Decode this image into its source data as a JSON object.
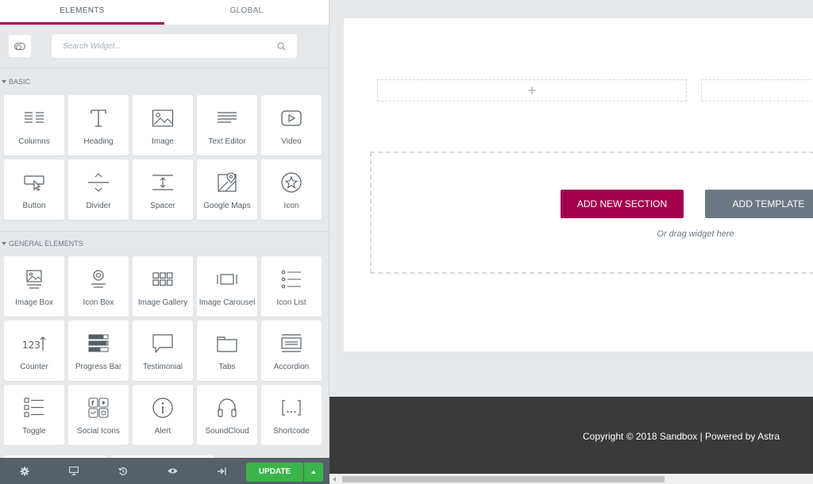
{
  "panel": {
    "tabs": [
      {
        "label": "ELEMENTS",
        "active": true
      },
      {
        "label": "GLOBAL",
        "active": false
      }
    ],
    "search": {
      "placeholder": "Search Widget..."
    },
    "categories": [
      {
        "title": "BASIC",
        "widgets": [
          {
            "label": "Columns",
            "icon": "columns-icon"
          },
          {
            "label": "Heading",
            "icon": "heading-icon"
          },
          {
            "label": "Image",
            "icon": "image-icon"
          },
          {
            "label": "Text Editor",
            "icon": "text-editor-icon"
          },
          {
            "label": "Video",
            "icon": "video-icon"
          },
          {
            "label": "Button",
            "icon": "button-icon"
          },
          {
            "label": "Divider",
            "icon": "divider-icon"
          },
          {
            "label": "Spacer",
            "icon": "spacer-icon"
          },
          {
            "label": "Google Maps",
            "icon": "google-maps-icon"
          },
          {
            "label": "Icon",
            "icon": "star-icon"
          }
        ]
      },
      {
        "title": "GENERAL ELEMENTS",
        "widgets": [
          {
            "label": "Image Box",
            "icon": "image-box-icon"
          },
          {
            "label": "Icon Box",
            "icon": "icon-box-icon"
          },
          {
            "label": "Image Gallery",
            "icon": "image-gallery-icon"
          },
          {
            "label": "Image Carousel",
            "icon": "image-carousel-icon"
          },
          {
            "label": "Icon List",
            "icon": "icon-list-icon"
          },
          {
            "label": "Counter",
            "icon": "counter-icon"
          },
          {
            "label": "Progress Bar",
            "icon": "progress-bar-icon"
          },
          {
            "label": "Testimonial",
            "icon": "testimonial-icon"
          },
          {
            "label": "Tabs",
            "icon": "tabs-icon"
          },
          {
            "label": "Accordion",
            "icon": "accordion-icon"
          },
          {
            "label": "Toggle",
            "icon": "toggle-icon"
          },
          {
            "label": "Social Icons",
            "icon": "social-icons-icon"
          },
          {
            "label": "Alert",
            "icon": "alert-icon"
          },
          {
            "label": "SoundCloud",
            "icon": "soundcloud-icon"
          },
          {
            "label": "Shortcode",
            "icon": "shortcode-icon"
          }
        ]
      }
    ],
    "toolbar": {
      "icons": [
        "settings-icon",
        "responsive-icon",
        "history-icon",
        "preview-icon",
        "exit-icon"
      ],
      "update_label": "UPDATE"
    }
  },
  "preview": {
    "add_section_label": "ADD NEW SECTION",
    "add_template_label": "ADD TEMPLATE",
    "drag_hint": "Or drag widget here",
    "column_add": "+",
    "footer_text": "Copyright © 2018 Sandbox | Powered by Astra"
  },
  "colors": {
    "accent": "#a4004f",
    "update": "#39b54a",
    "template_button": "#6d7882",
    "footer_bg": "#3a3a3a",
    "panel_bg": "#e6e9ec"
  }
}
